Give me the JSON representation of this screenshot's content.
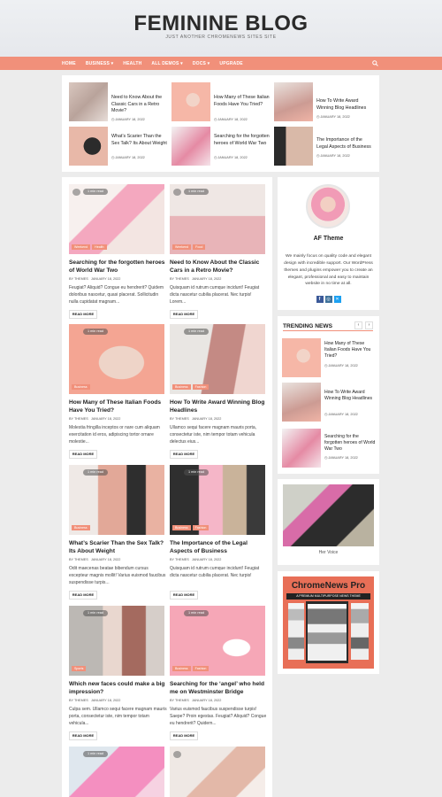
{
  "site": {
    "title": "FEMININE BLOG",
    "tagline": "JUST ANOTHER CHROMENEWS SITES SITE"
  },
  "nav": {
    "items": [
      "HOME",
      "BUSINESS ▾",
      "HEALTH",
      "ALL DEMOS ▾",
      "DOCS ▾",
      "UPGRADE"
    ],
    "search_icon": "search-icon"
  },
  "featured": [
    {
      "title": "Need to Know About the Classic Cars in a Retro Movie?",
      "date": "JANUARY 18, 2022"
    },
    {
      "title": "How Many of These Italian Foods Have You Tried?",
      "date": "JANUARY 18, 2022"
    },
    {
      "title": "How To Write Award Winning Blog Headlines",
      "date": "JANUARY 18, 2022"
    },
    {
      "title": "What’s Scarier Than the Sex Talk? Its About Weight",
      "date": "JANUARY 18, 2022"
    },
    {
      "title": "Searching for the forgotten heroes of World War Two",
      "date": "JANUARY 18, 2022"
    },
    {
      "title": "The Importance of the Legal Aspects of Business",
      "date": "JANUARY 18, 2022"
    }
  ],
  "posts": [
    {
      "read": "1 min read",
      "cats": [
        "Weekend",
        "Health"
      ],
      "title": "Searching for the forgotten heroes of World War Two",
      "author": "BY THEMES",
      "date": "JANUARY 18, 2022",
      "excerpt": "Feugiat? Aliquid? Congue eu hendrerit? Quidem doloribus nascetur, quasi placerat. Sollicitudin nulla cupidatat magnam...",
      "readmore": "READ MORE"
    },
    {
      "read": "1 min read",
      "cats": [
        "Weekend",
        "Food"
      ],
      "title": "Need to Know About the Classic Cars in a Retro Movie?",
      "author": "BY THEMES",
      "date": "JANUARY 18, 2022",
      "excerpt": "Quisquam id rutrum cumque incidunt! Feugiat dicta nascetur cubilia placerat. Nec turpis! Lorem...",
      "readmore": "READ MORE"
    },
    {
      "read": "1 min read",
      "cats": [
        "Business"
      ],
      "title": "How Many of These Italian Foods Have You Tried?",
      "author": "BY THEMES",
      "date": "JANUARY 18, 2022",
      "excerpt": "Molestia fringilla inceptos or nare cum aliquam exercitation id eros, adipiscing tortor ornare molestie...",
      "readmore": "READ MORE"
    },
    {
      "read": "1 min read",
      "cats": [
        "Business",
        "Fashion"
      ],
      "title": "How To Write Award Winning Blog Headlines",
      "author": "BY THEMES",
      "date": "JANUARY 18, 2022",
      "excerpt": "Ullamco sequi facere magnam mauris porta, consectetur iste, nim tempor totam vehicula delectus eius...",
      "readmore": "READ MORE"
    },
    {
      "read": "1 min read",
      "cats": [
        "Business"
      ],
      "title": "What’s Scarier Than the Sex Talk? Its About Weight",
      "author": "BY THEMES",
      "date": "JANUARY 18, 2022",
      "excerpt": "Odit maecenas beatae bibendum cursus excepteur magnis mollit! Varius euismod faucibus suspendisse turpis...",
      "readmore": "READ MORE"
    },
    {
      "read": "1 min read",
      "cats": [
        "Business",
        "Fashion"
      ],
      "title": "The Importance of the Legal Aspects of Business",
      "author": "BY THEMES",
      "date": "JANUARY 18, 2022",
      "excerpt": "Quisquam id rutrum cumque incidunt! Feugiat dicta nascetur cubilia placerat. Nec turpis!",
      "readmore": "READ MORE"
    },
    {
      "read": "1 min read",
      "cats": [
        "Sports"
      ],
      "title": "Which new faces could make a big impression?",
      "author": "BY THEMES",
      "date": "JANUARY 18, 2022",
      "excerpt": "Culpa sem. Ullamco sequi facere magnam mauris porta, consectetur iste, nim tempor totam vehicula...",
      "readmore": "READ MORE"
    },
    {
      "read": "1 min read",
      "cats": [
        "Business",
        "Fashion"
      ],
      "title": "Searching for the ‘angel’ who held me on Westminster Bridge",
      "author": "BY THEMES",
      "date": "JANUARY 18, 2022",
      "excerpt": "Varius euismod faucibus suspendisse turpis! Saepe? Proin egestas. Feugiat? Aliquid? Congue eu hendrerit? Quidem...",
      "readmore": "READ MORE"
    },
    {
      "read": "1 min read",
      "cats": [],
      "title": "",
      "author": "",
      "date": "",
      "excerpt": "",
      "readmore": ""
    },
    {
      "read": "",
      "cats": [],
      "title": "",
      "author": "",
      "date": "",
      "excerpt": "",
      "readmore": ""
    }
  ],
  "author_widget": {
    "name": "AF Theme",
    "bio": "We mainly focus on quality code and elegant design with incredible support. Our WordPress themes and plugins empower you to create an elegant, professional and easy to maintain website in no time at all.",
    "social_icons": [
      "facebook-icon",
      "instagram-icon",
      "twitter-icon"
    ]
  },
  "trending": {
    "title": "TRENDING NEWS",
    "items": [
      {
        "title": "How Many of These Italian Foods Have You Tried?",
        "date": "JANUARY 18, 2022"
      },
      {
        "title": "How To Write Award Winning Blog Headlines",
        "date": "JANUARY 18, 2022"
      },
      {
        "title": "Searching for the forgotten heroes of World War Two",
        "date": "JANUARY 18, 2022"
      }
    ]
  },
  "image_widget": {
    "caption": "Her Voice"
  },
  "ad_widget": {
    "title": "ChromeNews Pro",
    "subtitle": "A PREMIUM MULTIPURPOSE NEWS THEME"
  },
  "colors": {
    "accent": "#f1907a",
    "background": "#ececec"
  }
}
